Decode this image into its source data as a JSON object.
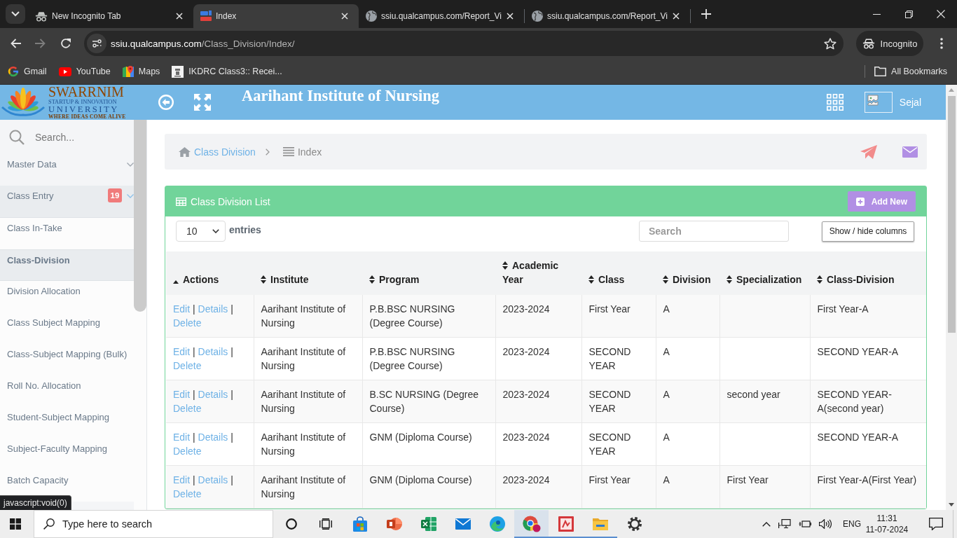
{
  "browser": {
    "tabs": [
      {
        "title": "New Incognito Tab",
        "kind": "incognito",
        "selected": false
      },
      {
        "title": "Index",
        "kind": "site",
        "selected": true
      },
      {
        "title": "ssiu.qualcampus.com/Report_Vi",
        "kind": "globe",
        "selected": false
      },
      {
        "title": "ssiu.qualcampus.com/Report_Vi",
        "kind": "globe",
        "selected": false
      }
    ],
    "address": {
      "host": "ssiu.qualcampus.com",
      "path": "/Class_Division/Index/"
    },
    "profile": "Incognito",
    "bookmarks": [
      {
        "label": "Gmail",
        "kind": "google"
      },
      {
        "label": "YouTube",
        "kind": "video"
      },
      {
        "label": "Maps",
        "kind": "map"
      },
      {
        "label": "IKDRC Class3:: Recei...",
        "kind": "emblem"
      }
    ],
    "all_bookmarks": "All Bookmarks"
  },
  "header": {
    "logo": {
      "name": "SWARRNIM",
      "line_1": "STARTUP & INNOVATION",
      "line_2": "UNIVERSITY",
      "tagline": "WHERE IDEAS COME ALIVE"
    },
    "title": "Aarihant Institute of Nursing",
    "user": "Sejal"
  },
  "sidebar": {
    "search": {
      "placeholder": "Search..."
    },
    "items": [
      {
        "label": "Master Data",
        "expanded": false
      },
      {
        "label": "Class Entry",
        "badge": "19",
        "expanded": true,
        "children": [
          {
            "label": "Class In-Take",
            "selected": false
          },
          {
            "label": "Class-Division",
            "selected": true
          },
          {
            "label": "Division Allocation",
            "selected": false
          },
          {
            "label": "Class Subject Mapping",
            "selected": false
          },
          {
            "label": "Class-Subject Mapping (Bulk)",
            "selected": false
          },
          {
            "label": "Roll No. Allocation",
            "selected": false
          },
          {
            "label": "Student-Subject Mapping",
            "selected": false
          },
          {
            "label": "Subject-Faculty Mapping",
            "selected": false
          },
          {
            "label": "Batch Capacity",
            "selected": false
          }
        ]
      }
    ]
  },
  "breadcrumb": [
    {
      "label": "Class Division",
      "kind": "home"
    },
    {
      "label": "Index",
      "kind": "list"
    }
  ],
  "panel": {
    "title": "Class Division List",
    "add_button": "Add New",
    "page_size": "10",
    "entries_label": "entries",
    "search": {
      "placeholder": "Search"
    },
    "columns_button": "Show / hide columns",
    "columns": [
      {
        "label": "Actions",
        "sorted": true
      },
      {
        "label": "Institute",
        "sorted": false
      },
      {
        "label": "Program",
        "sorted": false
      },
      {
        "label": "Academic Year",
        "sorted": false
      },
      {
        "label": "Class",
        "sorted": false
      },
      {
        "label": "Division",
        "sorted": false
      },
      {
        "label": "Specialization",
        "sorted": false
      },
      {
        "label": "Class-Division",
        "sorted": false
      }
    ],
    "rows": [
      {
        "actions": {
          "links": [
            "Edit",
            "Details",
            "Delete"
          ],
          "separator": "|"
        },
        "institute": "Aarihant Institute of Nursing",
        "program": "P.B.BSC NURSING (Degree Course)",
        "academic_year": "2023-2024",
        "class": "First Year",
        "division": "A",
        "class_division": "First Year-A"
      },
      {
        "actions": {
          "links": [
            "Edit",
            "Details",
            "Delete"
          ],
          "separator": "|"
        },
        "institute": "Aarihant Institute of Nursing",
        "program": "P.B.BSC NURSING (Degree Course)",
        "academic_year": "2023-2024",
        "class": "SECOND YEAR",
        "division": "A",
        "class_division": "SECOND YEAR-A"
      },
      {
        "actions": {
          "links": [
            "Edit",
            "Details",
            "Delete"
          ],
          "separator": "|"
        },
        "institute": "Aarihant Institute of Nursing",
        "program": "B.SC NURSING (Degree Course)",
        "academic_year": "2023-2024",
        "class": "SECOND YEAR",
        "division": "A",
        "specialization": "second year",
        "class_division": "SECOND YEAR-A(second year)"
      },
      {
        "actions": {
          "links": [
            "Edit",
            "Details",
            "Delete"
          ],
          "separator": "|"
        },
        "institute": "Aarihant Institute of Nursing",
        "program": "GNM (Diploma Course)",
        "academic_year": "2023-2024",
        "class": "SECOND YEAR",
        "division": "A",
        "class_division": "SECOND YEAR-A"
      },
      {
        "actions": {
          "links": [
            "Edit",
            "Details",
            "Delete"
          ],
          "separator": "|"
        },
        "institute": "Aarihant Institute of Nursing",
        "program": "GNM (Diploma Course)",
        "academic_year": "2023-2024",
        "class": "First Year",
        "division": "A",
        "specialization": "First Year",
        "class_division": "First Year-A(First Year)"
      }
    ]
  },
  "status_url": "javascript:void(0)",
  "taskbar": {
    "search": {
      "placeholder": "Type here to search"
    },
    "apps": [
      {
        "kind": "cortana",
        "open": false,
        "selected": false
      },
      {
        "kind": "task_view",
        "open": false,
        "selected": false
      },
      {
        "kind": "store",
        "open": false,
        "selected": false
      },
      {
        "kind": "slides",
        "open": false,
        "selected": false
      },
      {
        "kind": "sheets",
        "open": false,
        "selected": false
      },
      {
        "kind": "mail",
        "open": false,
        "selected": false
      },
      {
        "kind": "edge",
        "open": false,
        "selected": false
      },
      {
        "kind": "chrome",
        "open": true,
        "selected": true
      },
      {
        "kind": "pdf",
        "open": true,
        "selected": false
      },
      {
        "kind": "explorer",
        "open": true,
        "selected": false
      },
      {
        "kind": "settings",
        "open": false,
        "selected": false
      }
    ],
    "language": "ENG",
    "time": "11:31",
    "date": "11-07-2024"
  }
}
